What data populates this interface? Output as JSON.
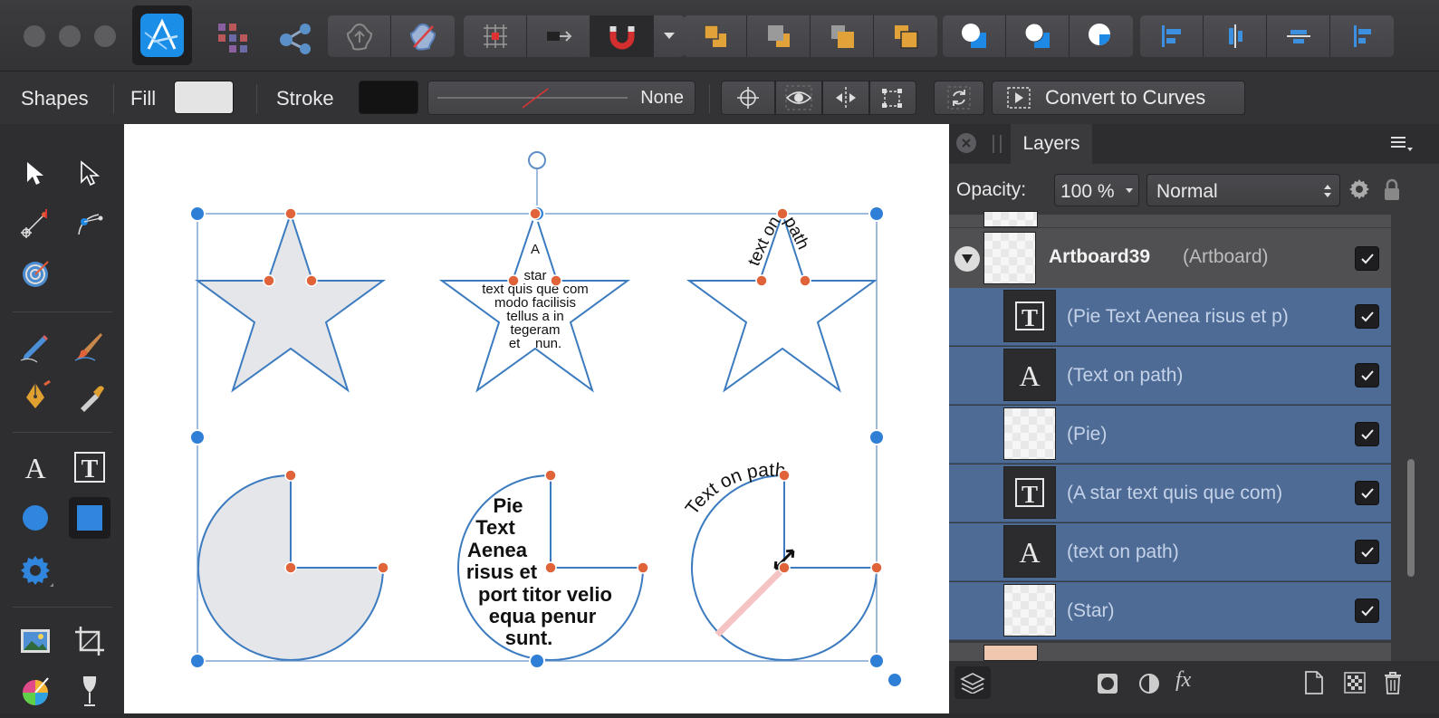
{
  "context_toolbar": {
    "tool_name": "Shapes",
    "fill_label": "Fill",
    "fill_color": "#e4e4e4",
    "stroke_label": "Stroke",
    "stroke_color": "#131313",
    "stroke_style_value": "None",
    "convert_to_curves_label": "Convert to Curves"
  },
  "canvas_text": {
    "star_text_lines": [
      "A",
      "star",
      "text quis que com",
      "modo facilisis",
      "tellus a in",
      "tegeram",
      "et    nun."
    ],
    "star_path_text": "text on path",
    "pie_text_lines": [
      "Pie",
      "Text",
      "Aenea",
      "risus et",
      "port titor velio",
      "equa penur",
      "sunt."
    ],
    "pie_path_text": "Text on path"
  },
  "layers_panel": {
    "tab_label": "Layers",
    "opacity_label": "Opacity:",
    "opacity_value": "100 %",
    "blend_mode": "Normal",
    "artboard": {
      "name": "Artboard39",
      "type": "(Artboard)"
    },
    "items": [
      {
        "name": "(Pie Text Aenea risus et p)",
        "thumb": "frame-text"
      },
      {
        "name": "(Text on path)",
        "thumb": "artistic-text"
      },
      {
        "name": "(Pie)",
        "thumb": "shape"
      },
      {
        "name": "(A star text quis que com)",
        "thumb": "frame-text"
      },
      {
        "name": "(text on path)",
        "thumb": "artistic-text"
      },
      {
        "name": "(Star)",
        "thumb": "shape"
      }
    ]
  },
  "colors": {
    "accent_blue": "#2f7fd6",
    "node_orange": "#e0633a",
    "selection_blue": "#4a7cbd",
    "shape_fill": "#e4e6e9",
    "shape_stroke": "#3c7bbf",
    "layer_selected_bg": "#4e6b96"
  },
  "icons": [
    "affinity-designer-logo",
    "persona-pixel-icon",
    "persona-export-icon",
    "snapping-magnet-icon",
    "move-tool-icon",
    "node-tool-icon",
    "pen-tool-icon",
    "artistic-text-icon",
    "frame-text-icon",
    "ellipse-tool-icon",
    "rectangle-tool-icon",
    "layers-icon",
    "mask-icon",
    "adjustment-icon",
    "fx-icon",
    "new-layer-icon",
    "checker-icon",
    "trash-icon"
  ]
}
